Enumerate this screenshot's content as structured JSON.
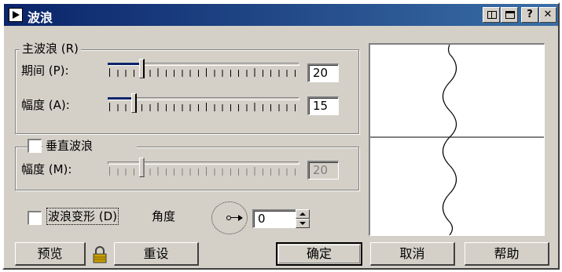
{
  "window": {
    "title": "波浪"
  },
  "title_buttons": {
    "help": "?",
    "close": "✕"
  },
  "main_wave": {
    "legend": "主波浪 (R)",
    "period_label": "期间 (P):",
    "period_value": "20",
    "period_level": 0.19,
    "amplitude_label": "幅度 (A):",
    "amplitude_value": "15",
    "amplitude_level": 0.14
  },
  "vertical_wave": {
    "legend": "垂直波浪",
    "checked": false,
    "amplitude_label": "幅度 (M):",
    "amplitude_value": "20",
    "amplitude_level": 0.19
  },
  "wave_deform": {
    "label": "波浪变形 (D)",
    "checked": false,
    "angle_label": "角度",
    "angle_value": "0"
  },
  "buttons": {
    "preview": "预览",
    "reset": "重设",
    "ok": "确定",
    "cancel": "取消",
    "help": "帮助"
  },
  "icons": {
    "window": "play-icon",
    "lock": "lock-icon",
    "dial": "angle-dial-icon"
  }
}
